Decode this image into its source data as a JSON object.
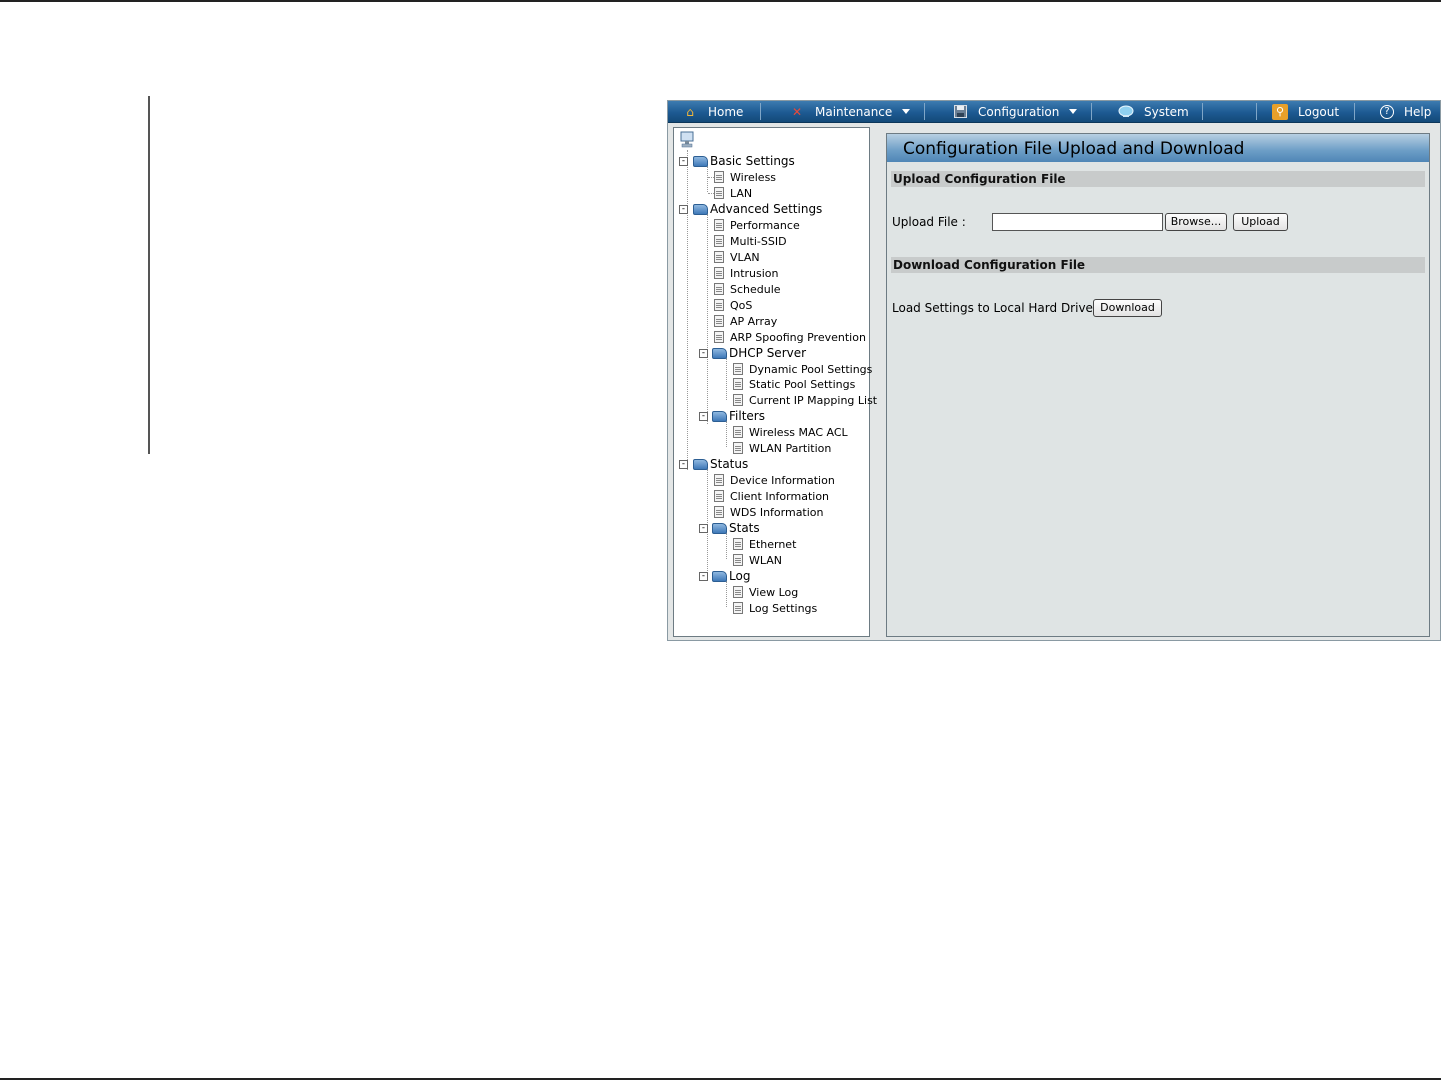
{
  "navbar": {
    "home": "Home",
    "maintenance": "Maintenance",
    "configuration": "Configuration",
    "system": "System",
    "logout": "Logout",
    "help": "Help"
  },
  "tree": {
    "basic_settings": "Basic Settings",
    "wireless": "Wireless",
    "lan": "LAN",
    "advanced_settings": "Advanced Settings",
    "performance": "Performance",
    "multi_ssid": "Multi-SSID",
    "vlan": "VLAN",
    "intrusion": "Intrusion",
    "schedule": "Schedule",
    "qos": "QoS",
    "ap_array": "AP Array",
    "arp_spoofing": "ARP Spoofing Prevention",
    "dhcp_server": "DHCP Server",
    "dynamic_pool": "Dynamic Pool Settings",
    "static_pool": "Static Pool Settings",
    "current_ip_mapping": "Current IP Mapping List",
    "filters": "Filters",
    "wireless_mac_acl": "Wireless MAC ACL",
    "wlan_partition": "WLAN Partition",
    "status": "Status",
    "device_information": "Device Information",
    "client_information": "Client Information",
    "wds_information": "WDS Information",
    "stats": "Stats",
    "ethernet": "Ethernet",
    "wlan": "WLAN",
    "log": "Log",
    "view_log": "View Log",
    "log_settings": "Log Settings"
  },
  "panel": {
    "title": "Configuration File Upload and Download",
    "upload_section": "Upload Configuration File",
    "upload_file_label": "Upload File :",
    "upload_file_value": "",
    "browse_button": "Browse...",
    "upload_button": "Upload",
    "download_section": "Download Configuration File",
    "load_settings_label": "Load Settings to Local Hard Drive",
    "download_button": "Download"
  },
  "colors": {
    "navbar": "#1d5a92",
    "panel_title": "#6c9dc6",
    "section_bar": "#c8cbcb",
    "panel_bg": "#dfe4e4"
  }
}
